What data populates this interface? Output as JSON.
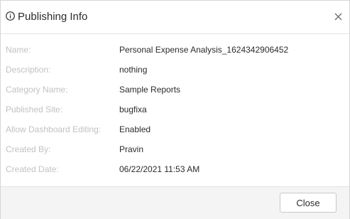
{
  "dialog": {
    "title": "Publishing Info",
    "close_button_label": "Close"
  },
  "fields": [
    {
      "label": "Name:",
      "value": "Personal Expense Analysis_1624342906452"
    },
    {
      "label": "Description:",
      "value": "nothing"
    },
    {
      "label": "Category Name:",
      "value": "Sample Reports"
    },
    {
      "label": "Published Site:",
      "value": "bugfixa"
    },
    {
      "label": "Allow Dashboard Editing:",
      "value": "Enabled"
    },
    {
      "label": "Created By:",
      "value": "Pravin"
    },
    {
      "label": "Created Date:",
      "value": "06/22/2021 11:53 AM"
    }
  ],
  "colors": {
    "label_text": "#c2c2c2",
    "value_text": "#2b2b2b",
    "footer_background": "#f4f4f4",
    "border": "#e4e4e4"
  },
  "icons": {
    "title": "info-icon",
    "dismiss": "close-icon"
  }
}
